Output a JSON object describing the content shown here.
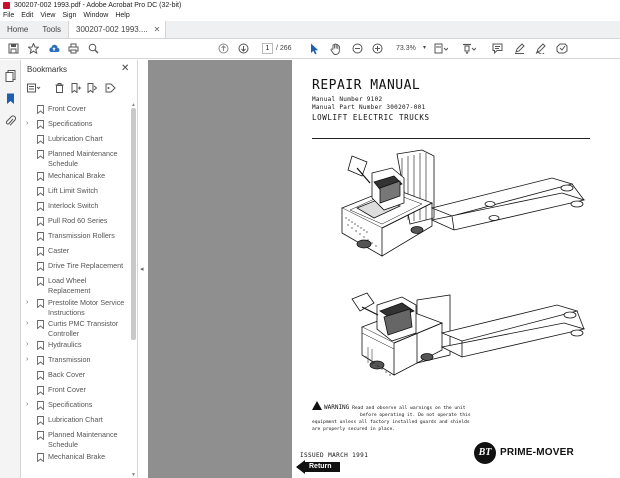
{
  "window": {
    "title": "300207-002 1993.pdf - Adobe Acrobat Pro DC (32-bit)"
  },
  "menu": [
    "File",
    "Edit",
    "View",
    "Sign",
    "Window",
    "Help"
  ],
  "tabs": {
    "home": "Home",
    "tools": "Tools",
    "document": "300207-002 1993...."
  },
  "toolbar": {
    "current_page": "1",
    "total_pages": "/ 266",
    "zoom": "73.3%"
  },
  "bookmarks": {
    "header": "Bookmarks",
    "items": [
      {
        "label": "Front Cover",
        "expandable": false
      },
      {
        "label": "Specifications",
        "expandable": true
      },
      {
        "label": "Lubrication Chart",
        "expandable": false
      },
      {
        "label": "Planned Maintenance Schedule",
        "expandable": false
      },
      {
        "label": "Mechanical Brake",
        "expandable": false
      },
      {
        "label": "Lift Limit Switch",
        "expandable": false
      },
      {
        "label": "Interlock Switch",
        "expandable": false
      },
      {
        "label": "Pull Rod 60 Series",
        "expandable": false
      },
      {
        "label": "Transmission Rollers",
        "expandable": false
      },
      {
        "label": "Caster",
        "expandable": false
      },
      {
        "label": "Drive Tire Replacement",
        "expandable": false
      },
      {
        "label": "Load Wheel Replacement",
        "expandable": false
      },
      {
        "label": "Prestolite Motor Service Instructions",
        "expandable": true
      },
      {
        "label": "Curtis PMC Transistor Controller",
        "expandable": true
      },
      {
        "label": "Hydraulics",
        "expandable": true
      },
      {
        "label": "Transmission",
        "expandable": true
      },
      {
        "label": "Back Cover",
        "expandable": false
      },
      {
        "label": "Front Cover",
        "expandable": false
      },
      {
        "label": "Specifications",
        "expandable": true
      },
      {
        "label": "Lubrication Chart",
        "expandable": false
      },
      {
        "label": "Planned Maintenance Schedule",
        "expandable": false
      },
      {
        "label": "Mechanical Brake",
        "expandable": false
      }
    ]
  },
  "document": {
    "title": "REPAIR MANUAL",
    "manual_number": "Manual Number 9102",
    "part_number": "Manual Part Number 300207-001",
    "subtitle": "LOWLIFT ELECTRIC TRUCKS",
    "warning_label": "WARNING",
    "warning_text_1": "Read and observe all warnings on the unit",
    "warning_text_2": "before operating it. Do not operate this",
    "warning_text_3": "equipment unless all factory installed guards and shields",
    "warning_text_4": "are properly secured in place.",
    "issued": "ISSUED MARCH 1991",
    "return_label": "Return",
    "logo_mark": "BT",
    "logo_name": "PRIME-MOVER"
  }
}
